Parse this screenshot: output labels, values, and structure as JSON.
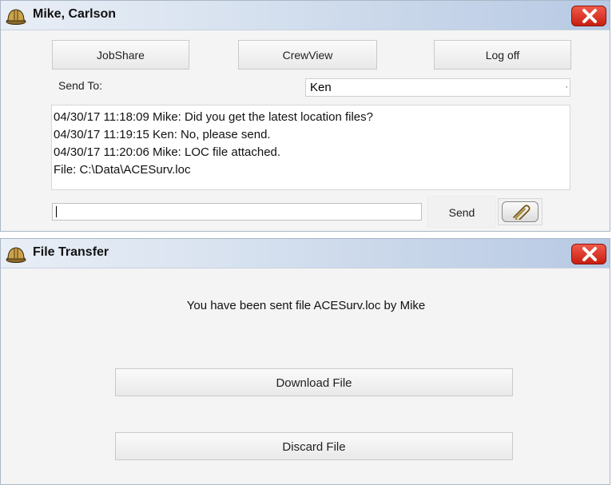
{
  "chat_window": {
    "title": "Mike, Carlson",
    "icon": "hard-hat-icon",
    "close_icon": "close-icon",
    "buttons": {
      "jobshare": "JobShare",
      "crewview": "CrewView",
      "logoff": "Log off"
    },
    "send_to_label": "Send To:",
    "recipient": "Ken",
    "messages": [
      "04/30/17 11:18:09 Mike:  Did you get the latest location files?",
      "04/30/17 11:19:15 Ken:  No, please send.",
      "04/30/17 11:20:06 Mike: LOC file attached.",
      "File: C:\\Data\\ACESurv.loc"
    ],
    "message_input_value": "",
    "send_label": "Send",
    "attach_icon": "paperclip-icon"
  },
  "file_window": {
    "title": "File Transfer",
    "icon": "hard-hat-icon",
    "close_icon": "close-icon",
    "message": "You have been sent file ACESurv.loc by Mike",
    "download_label": "Download File",
    "discard_label": "Discard File"
  },
  "colors": {
    "close_red": "#d8271a",
    "titlebar_start": "#e9eef6",
    "titlebar_end": "#b7c9e3"
  }
}
